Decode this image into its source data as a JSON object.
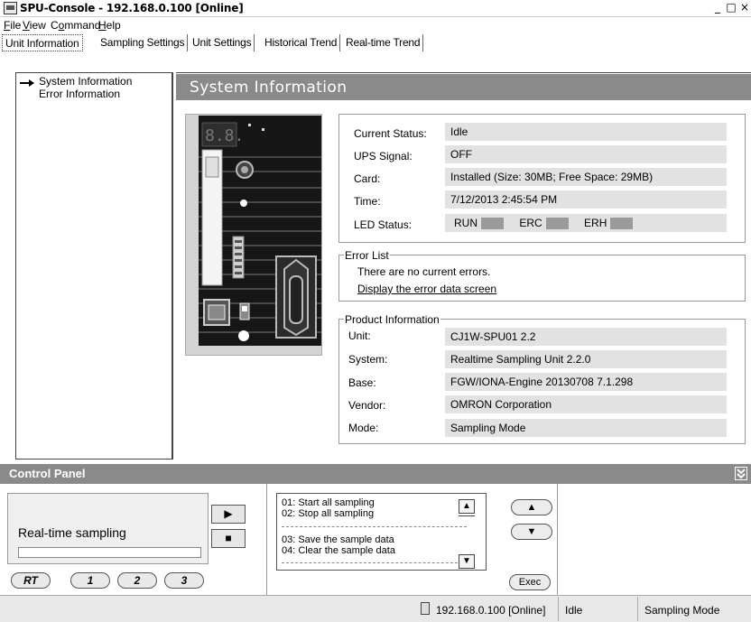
{
  "window": {
    "title": "SPU-Console - 192.168.0.100 [Online]",
    "controls": [
      "_",
      "□",
      "×"
    ]
  },
  "menu": {
    "file": {
      "mnemonic": "F",
      "rest": "ile"
    },
    "view": {
      "mnemonic": "V",
      "rest": "iew"
    },
    "command": {
      "pre": "C",
      "mnemonic": "o",
      "rest": "mmand"
    },
    "help": {
      "mnemonic": "H",
      "rest": "elp"
    }
  },
  "tabs": [
    {
      "label": "Unit Information",
      "active": true
    },
    {
      "label": "Sampling Settings",
      "active": false
    },
    {
      "label": "Unit Settings",
      "active": false
    },
    {
      "label": "Historical Trend",
      "active": false
    },
    {
      "label": "Real-time Trend",
      "active": false
    }
  ],
  "tree": {
    "items": [
      {
        "label": "System Information",
        "selected": true
      },
      {
        "label": "Error Information",
        "selected": false
      }
    ]
  },
  "system_info": {
    "header": "System Information",
    "status": {
      "current_status_label": "Current Status:",
      "current_status_value": "Idle",
      "ups_signal_label": "UPS Signal:",
      "ups_signal_value": "OFF",
      "card_label": "Card:",
      "card_value": "Installed  (Size: 30MB; Free Space: 29MB)",
      "time_label": "Time:",
      "time_value": "7/12/2013 2:45:54 PM",
      "led_label": "LED Status:",
      "leds": [
        "RUN",
        "ERC",
        "ERH"
      ],
      "led_color": "#9a9a9a"
    },
    "error_list": {
      "legend": "Error List",
      "message": "There are no current errors.",
      "link": "Display the error data screen"
    },
    "product_info": {
      "legend": "Product Information",
      "unit_label": "Unit:",
      "unit_value": "CJ1W-SPU01        2.2",
      "system_label": "System:",
      "system_value": "Realtime Sampling Unit  2.2.0",
      "base_label": "Base:",
      "base_value": "FGW/IONA-Engine 20130708  7.1.298",
      "vendor_label": "Vendor:",
      "vendor_value": "OMRON Corporation",
      "mode_label": "Mode:",
      "mode_value": "Sampling Mode"
    },
    "device_display": "8.8."
  },
  "control_panel": {
    "title": "Control Panel",
    "collapse_icon": "double-chevron-down-icon",
    "realtime_label": "Real-time sampling",
    "play_icon": "▶",
    "stop_icon": "■",
    "slots": [
      "RT",
      "1",
      "2",
      "3"
    ],
    "commands": [
      "01: Start all sampling",
      "02: Stop all sampling",
      "03: Save the sample data",
      "04: Clear the sample data"
    ],
    "up_icon": "▲",
    "down_icon": "▼",
    "exec_label": "Exec"
  },
  "statusbar": {
    "connection": "192.168.0.100 [Online]",
    "status": "Idle",
    "mode": "Sampling Mode"
  }
}
